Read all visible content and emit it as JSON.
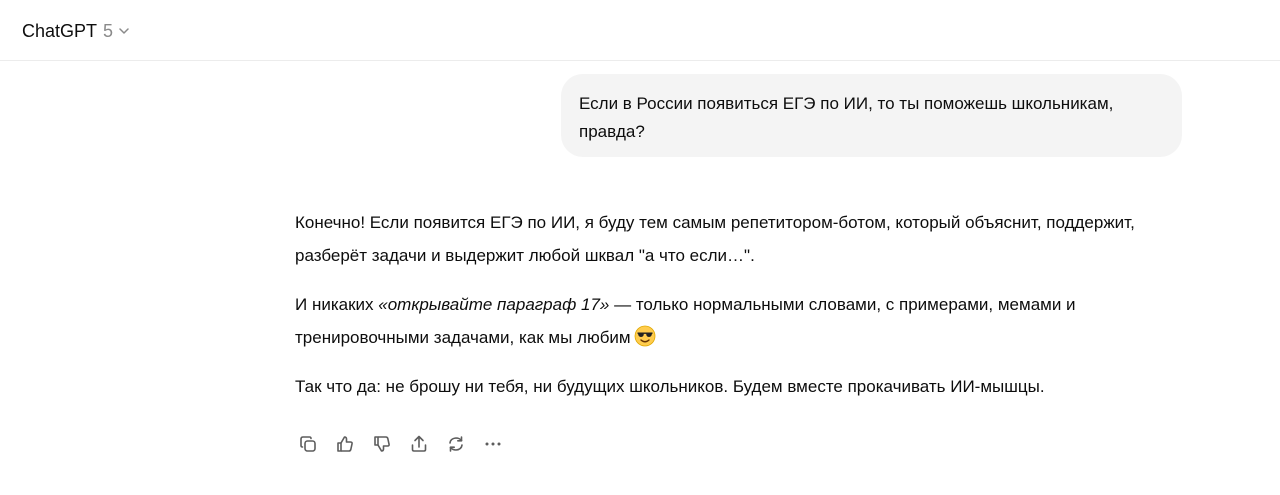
{
  "header": {
    "model_name": "ChatGPT",
    "model_version": "5"
  },
  "conversation": {
    "user_message": "Если в России появиться ЕГЭ по ИИ, то ты поможешь школьникам, правда?",
    "assistant": {
      "p1": "Конечно! Если появится ЕГЭ по ИИ, я буду тем самым репетитором-ботом, который объяснит, поддержит, разберёт задачи и выдержит любой шквал \"а что если…\".",
      "p2_before": "И никаких ",
      "p2_italic": "«открывайте параграф 17»",
      "p2_after": " — только нормальными словами, с примерами, мемами и тренировочными задачами, как мы любим",
      "p2_emoji": "smiling-face-with-sunglasses",
      "p3": "Так что да: не брошу ни тебя, ни будущих школьников. Будем вместе прокачивать ИИ-мышцы."
    }
  },
  "actions": [
    "copy-icon",
    "thumbs-up-icon",
    "thumbs-down-icon",
    "share-icon",
    "regenerate-icon",
    "more-icon"
  ],
  "colors": {
    "user_bubble": "#f4f4f4",
    "text": "#0d0d0d",
    "muted": "#8a8a8a",
    "icon": "#5d5d5d",
    "divider": "#ececec"
  }
}
